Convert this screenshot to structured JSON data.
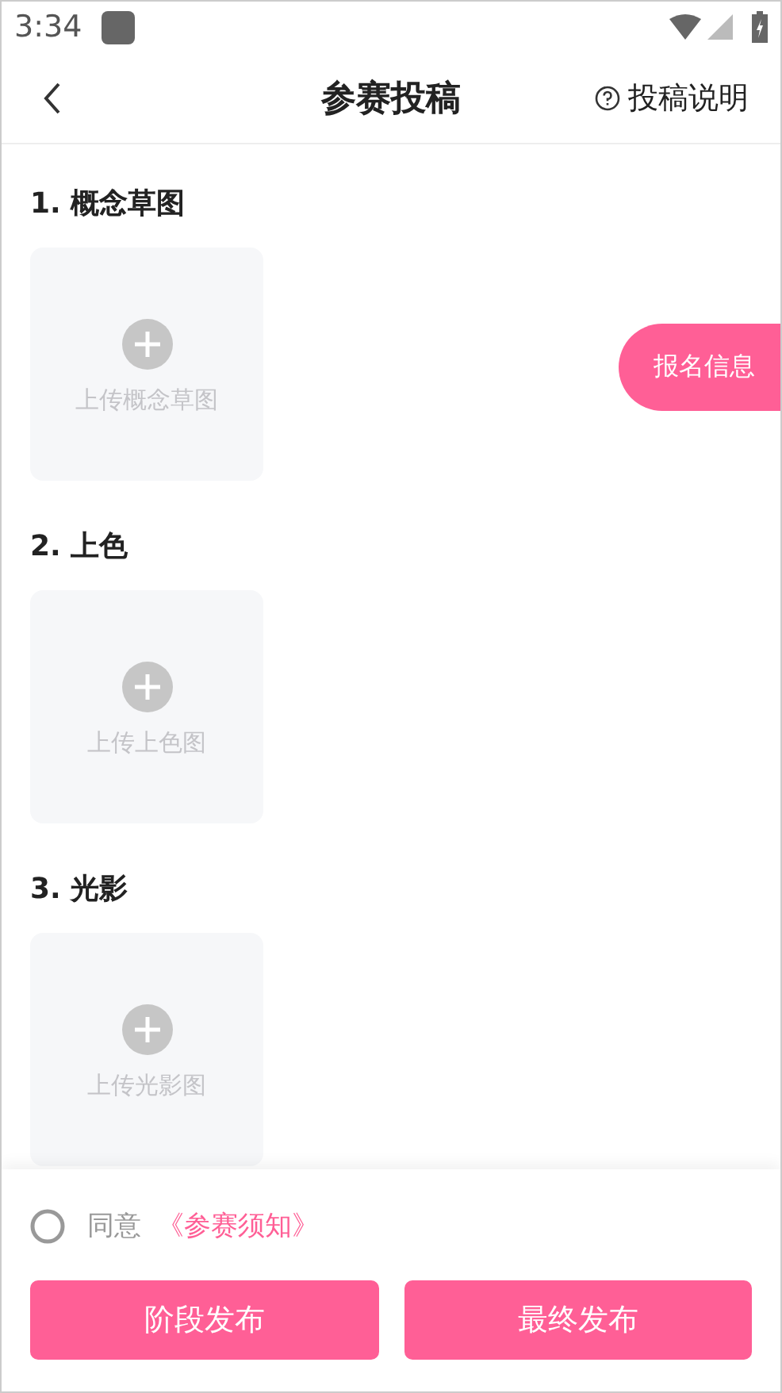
{
  "status_bar": {
    "time": "3:34"
  },
  "nav": {
    "title": "参赛投稿",
    "help_label": "投稿说明"
  },
  "sections": [
    {
      "heading": "1. 概念草图",
      "upload_label": "上传概念草图"
    },
    {
      "heading": "2. 上色",
      "upload_label": "上传上色图"
    },
    {
      "heading": "3. 光影",
      "upload_label": "上传光影图"
    }
  ],
  "float_tab": {
    "label": "报名信息"
  },
  "agreement": {
    "checked": false,
    "prefix": "同意",
    "link": "《参赛须知》"
  },
  "buttons": [
    {
      "label": "阶段发布"
    },
    {
      "label": "最终发布"
    }
  ]
}
